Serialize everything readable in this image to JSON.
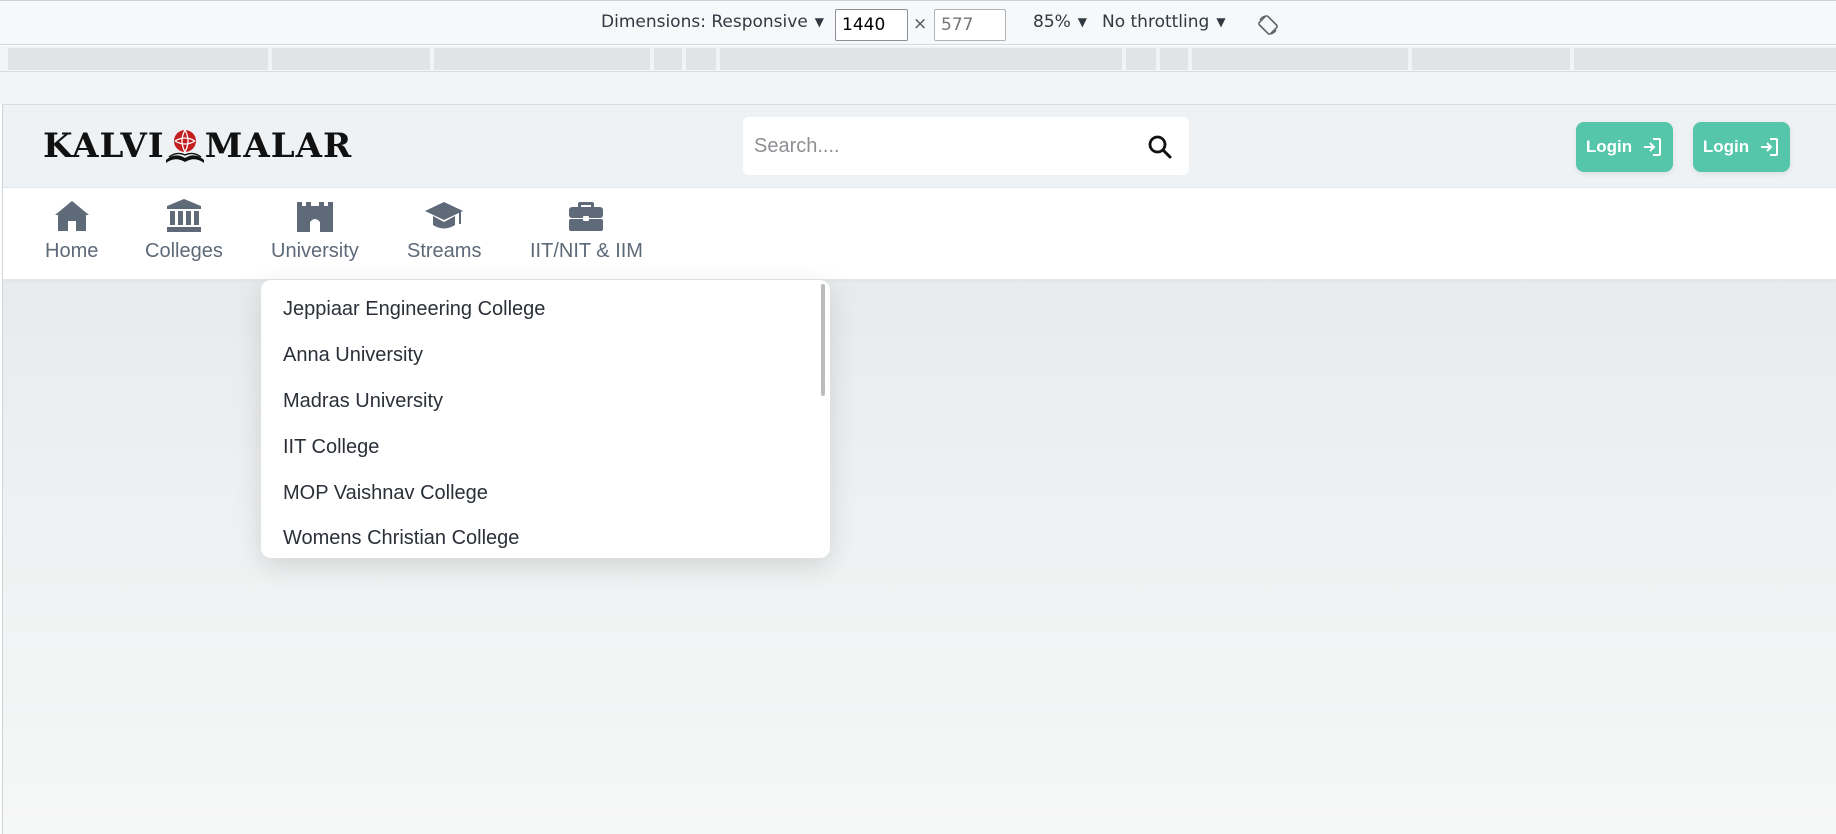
{
  "devtools": {
    "dimensions_label": "Dimensions: Responsive",
    "width_value": "1440",
    "height_value": "577",
    "times_symbol": "×",
    "zoom": "85%",
    "throttling": "No throttling",
    "caret": "▼",
    "rotate_icon": "rotate-icon"
  },
  "header": {
    "logo_left": "KALVI",
    "logo_right": "MALAR",
    "search_placeholder": "Search....",
    "login_buttons": [
      "Login",
      "Login"
    ]
  },
  "nav": {
    "items": [
      {
        "label": "Home",
        "icon": "home-icon"
      },
      {
        "label": "Colleges",
        "icon": "institution-icon"
      },
      {
        "label": "University",
        "icon": "castle-icon"
      },
      {
        "label": "Streams",
        "icon": "graduation-cap-icon"
      },
      {
        "label": "IIT/NIT & IIM",
        "icon": "briefcase-icon"
      }
    ]
  },
  "dropdown": {
    "items": [
      "Jeppiaar Engineering College",
      "Anna University",
      "Madras University",
      "IIT College",
      "MOP Vaishnav College",
      "Womens Christian College"
    ]
  },
  "colors": {
    "accent": "#55c6a9",
    "nav_icon": "#5e6a78",
    "header_bg": "#eef2f4"
  }
}
